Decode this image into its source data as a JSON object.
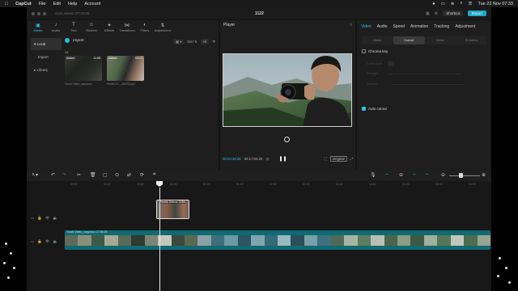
{
  "menubar": {
    "app_name": "CapCut",
    "items": [
      "File",
      "Edit",
      "Help",
      "Account"
    ],
    "datetime": "Tue 22 Nov  07:33"
  },
  "titlebar": {
    "autosave": "Auto saved: 07:33:28",
    "project": "1122",
    "shortcut_label": "Shortcut",
    "export_label": "Export"
  },
  "media": {
    "tabs": [
      {
        "label": "Media",
        "icon": "media-icon"
      },
      {
        "label": "Audio",
        "icon": "audio-icon"
      },
      {
        "label": "Text",
        "icon": "text-icon"
      },
      {
        "label": "Stickers",
        "icon": "stickers-icon"
      },
      {
        "label": "Effects",
        "icon": "effects-icon"
      },
      {
        "label": "Transitions",
        "icon": "transitions-icon"
      },
      {
        "label": "Filters",
        "icon": "filters-icon"
      },
      {
        "label": "Adjustment",
        "icon": "adjustment-icon"
      }
    ],
    "side": [
      "Local",
      "Import",
      "Library"
    ],
    "import_label": "Import",
    "sort_label": "Sort",
    "all_filter": "All",
    "all_label": "All",
    "items": [
      {
        "badge": "Added",
        "duration": "11:05",
        "caption": "Touch Video_copy.mov"
      },
      {
        "badge": "Added",
        "duration": "00:17",
        "caption": "Pexels Vi..._38323.mp4"
      }
    ]
  },
  "player": {
    "title": "Player",
    "current_time": "00:03:36:28",
    "total_time": "00:17:04:20",
    "original_label": "Original"
  },
  "inspector": {
    "tabs": [
      "Video",
      "Audio",
      "Speed",
      "Animation",
      "Tracking",
      "Adjustment"
    ],
    "subtabs": [
      "Basic",
      "Cutout",
      "Mask",
      "Enhance"
    ],
    "chroma_key": "Chroma key",
    "color_picker": "Color picker",
    "strength": "Strength",
    "shadow": "Shadow",
    "auto_cutout": "Auto cutout"
  },
  "timeline": {
    "ruler": [
      "00:00",
      "00:20",
      "00:40",
      "01:00",
      "01:20",
      "01:40",
      "02:00",
      "02:20",
      "02:40",
      "03:00",
      "03:20",
      "03:40",
      "04:00"
    ],
    "overlay_clip_label": "Pexels Videos 2259",
    "main_clip_label": "Touch Video_copy.mov  17:04:20"
  },
  "colors": {
    "accent": "#2dc0e0",
    "track": "#106a73",
    "bg": "#141414"
  }
}
